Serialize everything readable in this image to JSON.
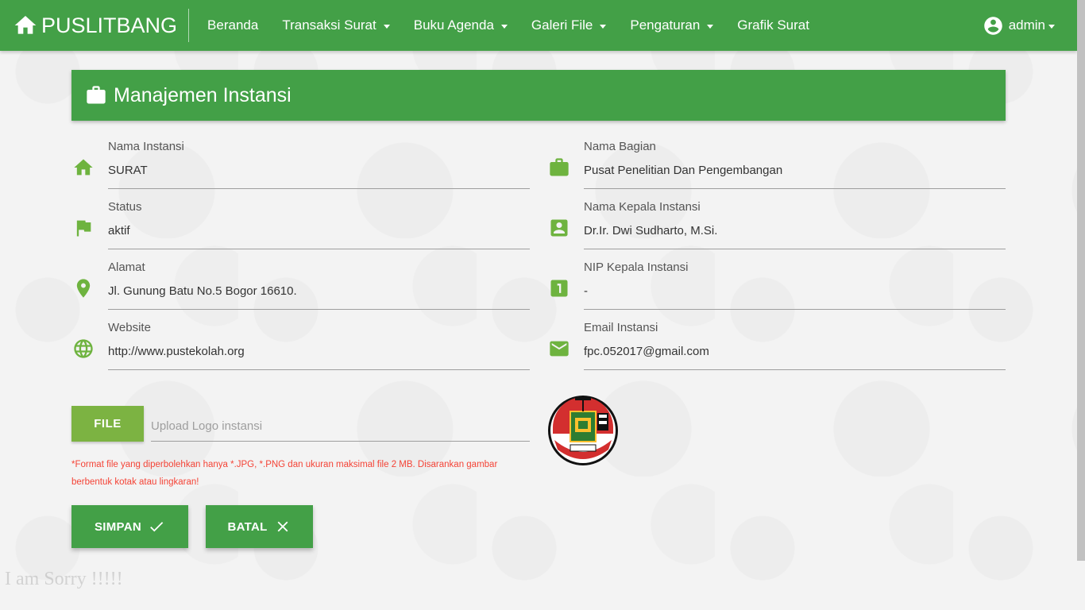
{
  "navbar": {
    "brand": "PUSLITBANG",
    "items": [
      {
        "label": "Beranda",
        "dropdown": false
      },
      {
        "label": "Transaksi Surat",
        "dropdown": true
      },
      {
        "label": "Buku Agenda",
        "dropdown": true
      },
      {
        "label": "Galeri File",
        "dropdown": true
      },
      {
        "label": "Pengaturan",
        "dropdown": true
      },
      {
        "label": "Grafik Surat",
        "dropdown": false
      }
    ],
    "user": "admin"
  },
  "panel": {
    "title": "Manajemen Instansi"
  },
  "fields": {
    "nama_instansi": {
      "label": "Nama Instansi",
      "value": "SURAT",
      "icon": "home-icon"
    },
    "status": {
      "label": "Status",
      "value": "aktif",
      "icon": "flag-icon"
    },
    "alamat": {
      "label": "Alamat",
      "value": "Jl. Gunung Batu No.5 Bogor 16610.",
      "icon": "location-pin-icon"
    },
    "website": {
      "label": "Website",
      "value": "http://www.pustekolah.org",
      "icon": "globe-icon"
    },
    "nama_bagian": {
      "label": "Nama Bagian",
      "value": "Pusat Penelitian Dan Pengembangan",
      "icon": "briefcase-icon"
    },
    "nama_kepala": {
      "label": "Nama Kepala Instansi",
      "value": "Dr.Ir. Dwi Sudharto, M.Si.",
      "icon": "contact-card-icon"
    },
    "nip_kepala": {
      "label": "NIP Kepala Instansi",
      "value": "-",
      "icon": "number-one-icon"
    },
    "email": {
      "label": "Email Instansi",
      "value": "fpc.052017@gmail.com",
      "icon": "mail-icon"
    }
  },
  "upload": {
    "button_label": "FILE",
    "placeholder": "Upload Logo instansi",
    "note": "*Format file yang diperbolehkan hanya *.JPG, *.PNG dan ukuran maksimal file 2 MB. Disarankan gambar berbentuk kotak atau lingkaran!"
  },
  "actions": {
    "save_label": "SIMPAN",
    "cancel_label": "BATAL"
  },
  "footer_text": "I am Sorry !!!!!",
  "colors": {
    "primary": "#43a047",
    "accent": "#7cb342",
    "icon": "#6eb33f",
    "warning": "#f44336"
  }
}
